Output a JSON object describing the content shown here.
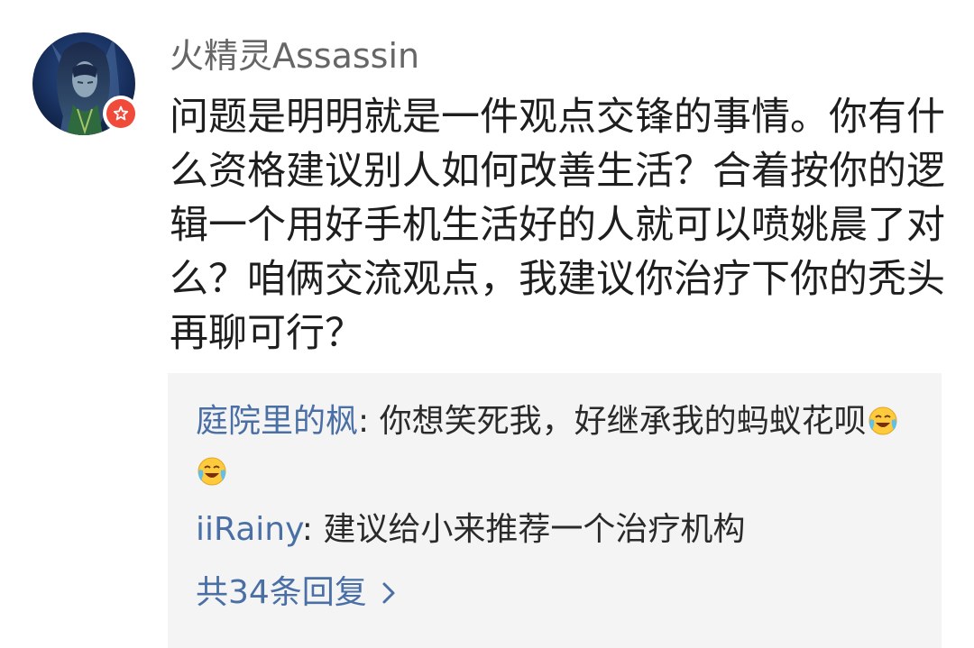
{
  "comment": {
    "username": "火精灵Assassin",
    "text": "问题是明明就是一件观点交锋的事情。你有什么资格建议别人如何改善生活？合着按你的逻辑一个用好手机生活好的人就可以喷姚晨了对么？咱俩交流观点，我建议你治疗下你的秃头再聊可行？",
    "avatar_icon": "anime-character-avatar",
    "badge_icon": "star-badge-icon"
  },
  "replies": [
    {
      "author": "庭院里的枫",
      "separator": ": ",
      "text": "你想笑死我，好继承我的蚂蚁花呗",
      "emoji": [
        "crying-laughing-emoji",
        "crying-laughing-emoji"
      ]
    },
    {
      "author": "iiRainy",
      "separator": ": ",
      "text": "建议给小来推荐一个治疗机构"
    }
  ],
  "more_replies": {
    "label": "共34条回复",
    "icon": "chevron-right-icon"
  },
  "colors": {
    "link": "#4a6fa5",
    "badge": "#f04a3a",
    "reply_bg": "#f4f4f4"
  }
}
